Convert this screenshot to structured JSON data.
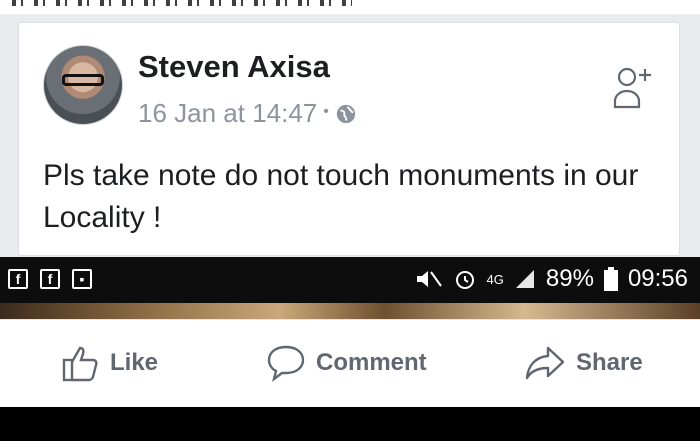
{
  "post": {
    "author": "Steven Axisa",
    "timestamp": "16 Jan at 14:47",
    "separator": "•",
    "audience_icon": "globe-icon",
    "text": "Pls take note do not touch monuments in our Locality !"
  },
  "statusbar": {
    "left_icons": [
      "facebook-icon",
      "facebook-icon",
      "gallery-icon"
    ],
    "network": "4G",
    "battery": "89%",
    "time": "09:56"
  },
  "actions": {
    "like": "Like",
    "comment": "Comment",
    "share": "Share"
  },
  "colors": {
    "text_primary": "#1c1e21",
    "text_secondary": "#8d949e",
    "action_text": "#606770",
    "status_bg": "#0d0d0d"
  }
}
